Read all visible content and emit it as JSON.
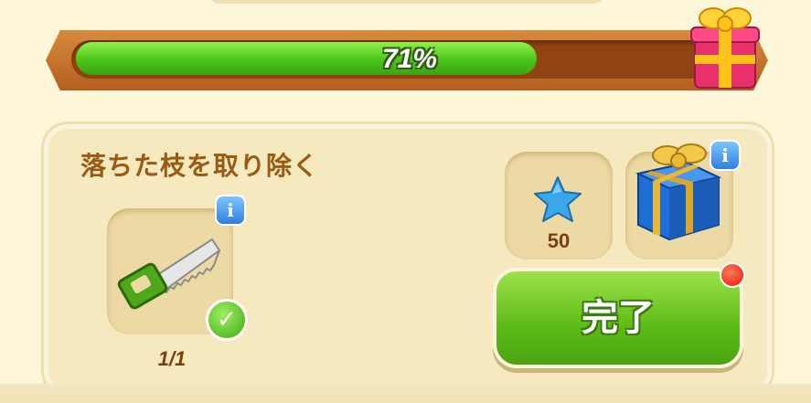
{
  "progress": {
    "value_percent": 71,
    "label": "71%"
  },
  "quest": {
    "title": "落ちた枝を取り除く",
    "tool": {
      "icon": "saw-icon",
      "count_label": "1/1",
      "completed": true
    },
    "rewards": [
      {
        "icon": "blue-star-icon",
        "value": "50"
      },
      {
        "icon": "blue-gift-box-icon"
      }
    ],
    "complete_button": "完了"
  },
  "info_glyph": "i",
  "check_glyph": "✓",
  "colors": {
    "progress_fill": "#5fd21f",
    "title_text": "#9a5a14",
    "button_green": "#5dbb17",
    "info_blue": "#2f7fe0",
    "notification_red": "#e61a0a"
  }
}
